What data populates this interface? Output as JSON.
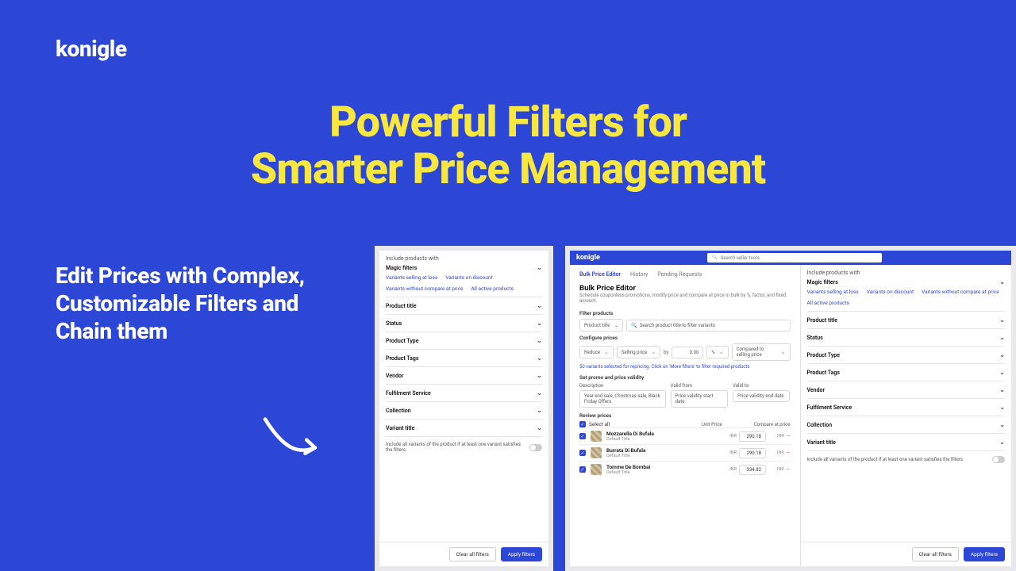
{
  "brand": "konigle",
  "hero": {
    "line1": "Powerful Filters for",
    "line2": "Smarter Price Management"
  },
  "subhead": "Edit Prices with Complex, Customizable Filters and Chain them",
  "filters": {
    "include_label": "Include products with",
    "magic_label": "Magic filters",
    "magic_links": [
      "Variants selling at loss",
      "Variants on discount",
      "Variants without compare at price",
      "All active products"
    ],
    "groups": [
      "Product title",
      "Status",
      "Product Type",
      "Product Tags",
      "Vendor",
      "Fulfilment Service",
      "Collection",
      "Variant title"
    ],
    "note": "Include all variants of the product if at least one variant satisfies the filters",
    "clear": "Clear all filters",
    "apply": "Apply filters"
  },
  "app": {
    "search_placeholder": "Search seller tools",
    "tabs": [
      "Bulk Price Editor",
      "History",
      "Pending Requests"
    ],
    "title": "Bulk Price Editor",
    "subtitle": "Schedule couponless promotions, modify price and compare at price in bulk by %, factor, and fixed amount.",
    "filter_products": {
      "label": "Filter products",
      "select": "Product title",
      "search_placeholder": "Search product title to filter variants"
    },
    "configure": {
      "label": "Configure prices",
      "reduce": "Reduce",
      "selling": "Selling price",
      "by": "by",
      "amount": "0.00",
      "unit": "%",
      "compared": "Compared to selling price",
      "info": "50 variants selected for repricing. Click on 'More filters' to filter required products"
    },
    "validity": {
      "label": "Set promo and price validity",
      "desc_label": "Description",
      "desc_ph": "Year end sale, Christmas sale, Black Friday Offers",
      "from_label": "Valid from",
      "from_ph": "Price validity start date",
      "to_label": "Valid to",
      "to_ph": "Price validity end date"
    },
    "review": {
      "label": "Review prices",
      "select_all": "Select all",
      "col_unit": "Unit Price",
      "col_compare": "Compare at price",
      "currency": "INR",
      "dash": "—",
      "rows": [
        {
          "name": "Mozzarella Di Bufala",
          "sub": "Default Title",
          "price": "290.18"
        },
        {
          "name": "Burrata Di Bufala",
          "sub": "Default Title",
          "price": "290.18"
        },
        {
          "name": "Tomme De Bombai",
          "sub": "Default Title",
          "price": "334.82"
        }
      ]
    }
  }
}
